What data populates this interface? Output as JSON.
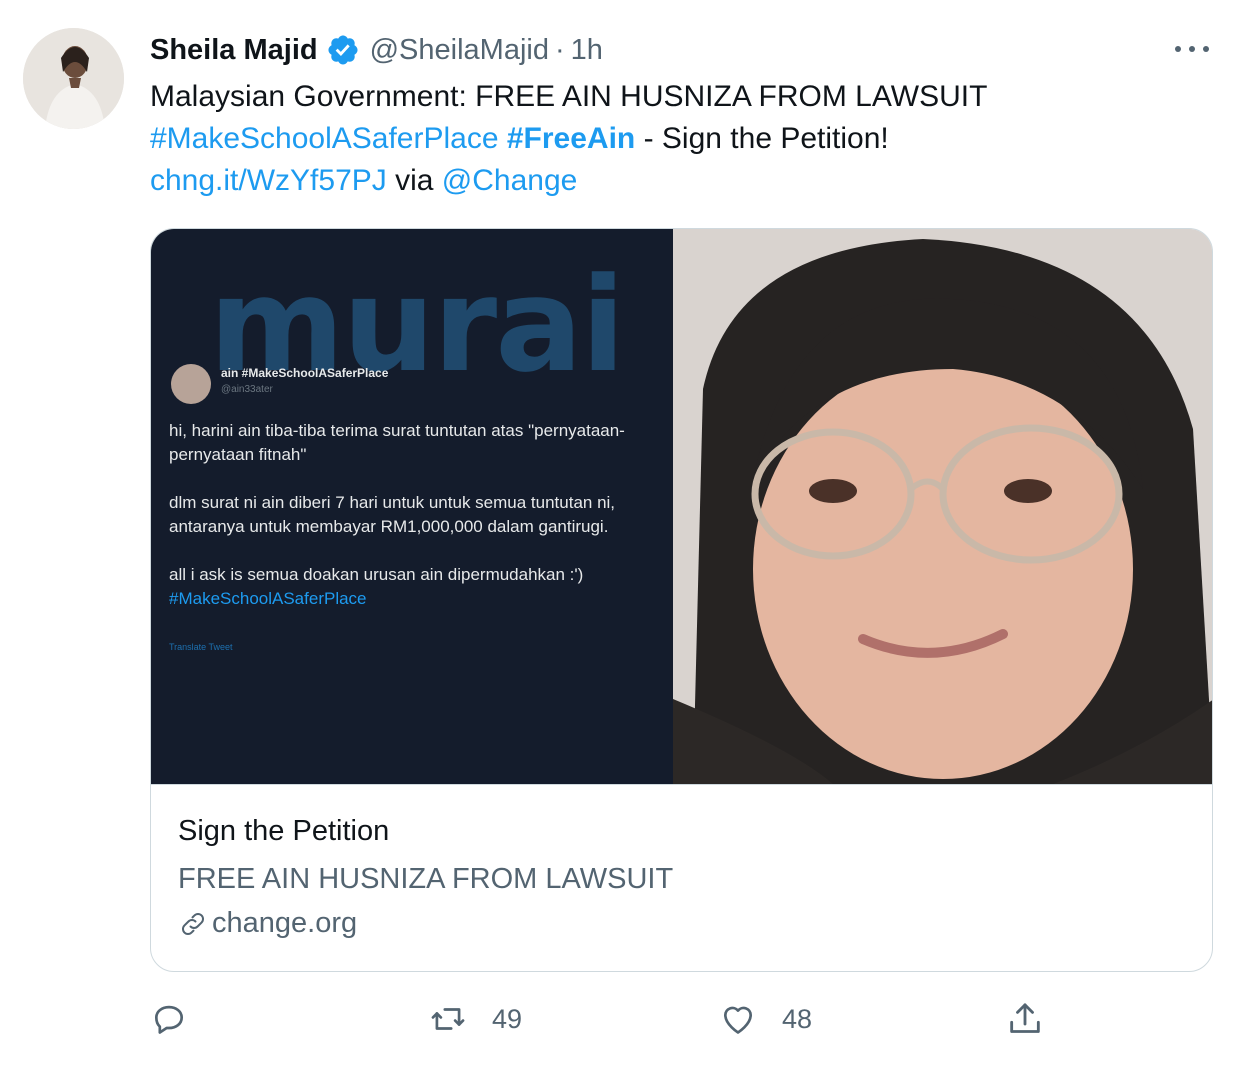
{
  "tweet": {
    "author_name": "Sheila Majid",
    "handle": "@SheilaMajid",
    "separator": "·",
    "time": "1h",
    "text_line1": "Malaysian Government: FREE AIN HUSNIZA FROM LAWSUIT",
    "hashtag1": "#MakeSchoolASaferPlace",
    "hashtag2": "#FreeAin",
    "text_line2_suffix": " - Sign the Petition!",
    "link": "chng.it/WzYf57PJ",
    "via": " via ",
    "mention": "@Change"
  },
  "card": {
    "watermark": "murai",
    "embedded": {
      "name": "ain #MakeSchoolASaferPlace",
      "handle": "@ain33ater",
      "para1": "hi, harini ain tiba-tiba terima surat tuntutan atas \"pernyataan-pernyataan fitnah\"",
      "para2": "dlm surat ni ain diberi 7 hari untuk untuk semua tuntutan ni, antaranya untuk membayar RM1,000,000 dalam gantirugi.",
      "para3": "all i ask is semua doakan urusan ain dipermudahkan :')",
      "hashtag": "#MakeSchoolASaferPlace",
      "translate": "Translate Tweet"
    },
    "title": "Sign the Petition",
    "description": "FREE AIN HUSNIZA FROM LAWSUIT",
    "domain": "change.org"
  },
  "actions": {
    "replies": "",
    "retweets": "49",
    "likes": "48"
  },
  "icons": {
    "verified": "verified-badge-icon",
    "more": "more-icon",
    "reply": "reply-icon",
    "retweet": "retweet-icon",
    "like": "heart-icon",
    "share": "share-icon",
    "link": "link-icon"
  },
  "colors": {
    "accent": "#1d9bf0",
    "muted": "#536471",
    "text": "#0f1419"
  }
}
